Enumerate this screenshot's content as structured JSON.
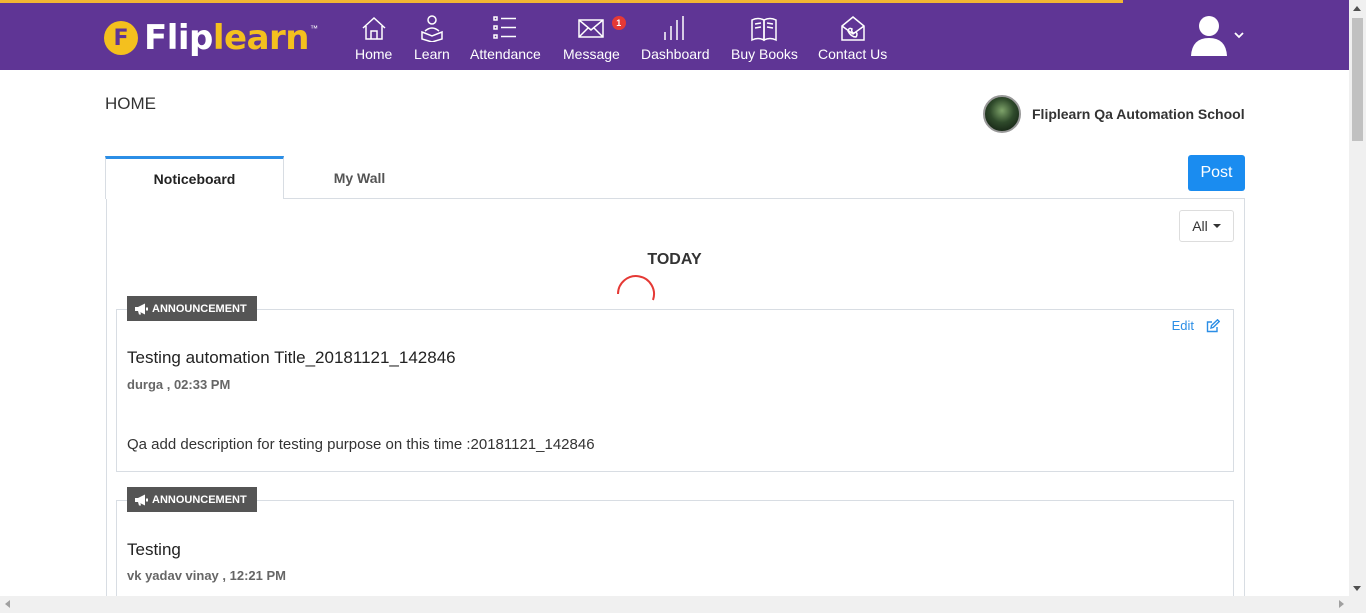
{
  "header": {
    "logo": {
      "part1": "Flip",
      "part2": "learn",
      "tm": "™",
      "badge": "F"
    },
    "nav": [
      {
        "label": "Home",
        "icon": "home-icon"
      },
      {
        "label": "Learn",
        "icon": "learn-icon"
      },
      {
        "label": "Attendance",
        "icon": "attendance-icon"
      },
      {
        "label": "Message",
        "icon": "message-icon",
        "badge": "1"
      },
      {
        "label": "Dashboard",
        "icon": "dashboard-icon"
      },
      {
        "label": "Buy Books",
        "icon": "books-icon"
      },
      {
        "label": "Contact Us",
        "icon": "contact-icon"
      }
    ],
    "colors": {
      "background": "#5f3595",
      "accent": "#f4c01e"
    }
  },
  "main": {
    "page_title": "HOME",
    "school_name": "Fliplearn Qa Automation School",
    "tabs": [
      {
        "label": "Noticeboard",
        "active": true
      },
      {
        "label": "My Wall",
        "active": false
      }
    ],
    "post_button": "Post",
    "filter": {
      "selected": "All"
    },
    "section_heading": "TODAY",
    "cards": [
      {
        "tag": "ANNOUNCEMENT",
        "title": "Testing automation Title_20181121_142846",
        "meta": "durga , 02:33 PM",
        "description": "Qa add description for testing purpose on this time :20181121_142846",
        "edit_label": "Edit"
      },
      {
        "tag": "ANNOUNCEMENT",
        "title": "Testing",
        "meta": "vk yadav vinay , 12:21 PM"
      }
    ]
  }
}
